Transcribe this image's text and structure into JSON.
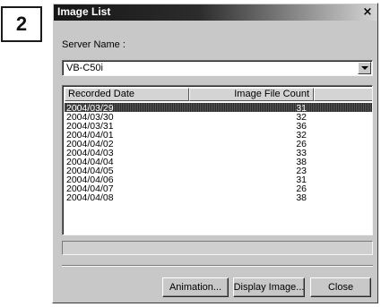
{
  "step_label": "2",
  "window": {
    "title": "Image List",
    "close_glyph": "×"
  },
  "server": {
    "label": "Server Name :",
    "value": "VB-C50i"
  },
  "list": {
    "columns": [
      "Recorded Date",
      "Image File Count"
    ],
    "selected_index": 0,
    "rows": [
      {
        "date": "2004/03/29",
        "count": "31"
      },
      {
        "date": "2004/03/30",
        "count": "32"
      },
      {
        "date": "2004/03/31",
        "count": "36"
      },
      {
        "date": "2004/04/01",
        "count": "32"
      },
      {
        "date": "2004/04/02",
        "count": "26"
      },
      {
        "date": "2004/04/03",
        "count": "33"
      },
      {
        "date": "2004/04/04",
        "count": "38"
      },
      {
        "date": "2004/04/05",
        "count": "23"
      },
      {
        "date": "2004/04/06",
        "count": "31"
      },
      {
        "date": "2004/04/07",
        "count": "26"
      },
      {
        "date": "2004/04/08",
        "count": "38"
      }
    ]
  },
  "buttons": {
    "animation": "Animation...",
    "display": "Display Image...",
    "close": "Close"
  }
}
